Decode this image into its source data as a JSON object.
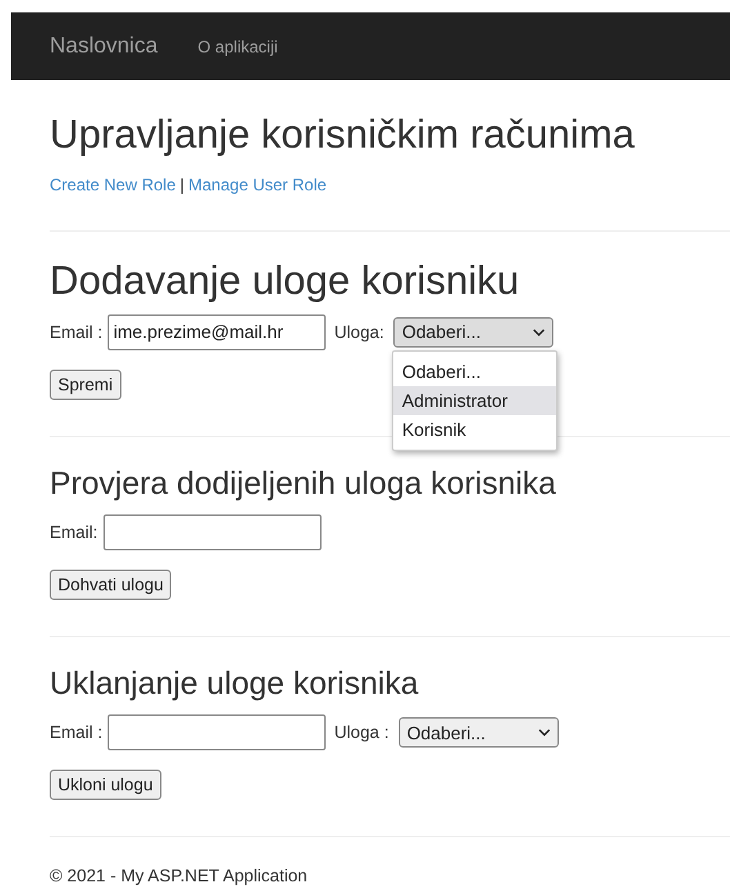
{
  "navbar": {
    "brand": "Naslovnica",
    "links": [
      {
        "label": "O aplikaciji"
      }
    ]
  },
  "page": {
    "title": "Upravljanje korisničkim računima",
    "links": [
      "Create New Role",
      "Manage User Role"
    ],
    "separator": "|"
  },
  "sections": [
    {
      "kind": "major",
      "title": "Dodavanje uloge korisniku",
      "fields": [
        {
          "kind": "text",
          "label": "Email :",
          "value": "ime.prezime@mail.hr"
        },
        {
          "kind": "select",
          "label": "Uloga:",
          "value": "Odaberi...",
          "open": true,
          "options": [
            {
              "label": "Odaberi...",
              "highlighted": false
            },
            {
              "label": "Administrator",
              "highlighted": true
            },
            {
              "label": "Korisnik",
              "highlighted": false
            }
          ]
        }
      ],
      "button": "Spremi"
    },
    {
      "kind": "minor",
      "title": "Provjera dodijeljenih uloga korisnika",
      "fields": [
        {
          "kind": "text",
          "label": "Email:"
        }
      ],
      "button": "Dohvati ulogu"
    },
    {
      "kind": "minor",
      "title": "Uklanjanje uloge korisnika",
      "fields": [
        {
          "kind": "text",
          "label": "Email :"
        },
        {
          "kind": "select",
          "label": "Uloga :",
          "value": "Odaberi..."
        }
      ],
      "button": "Ukloni ulogu"
    }
  ],
  "footer": "© 2021 - My ASP.NET Application"
}
